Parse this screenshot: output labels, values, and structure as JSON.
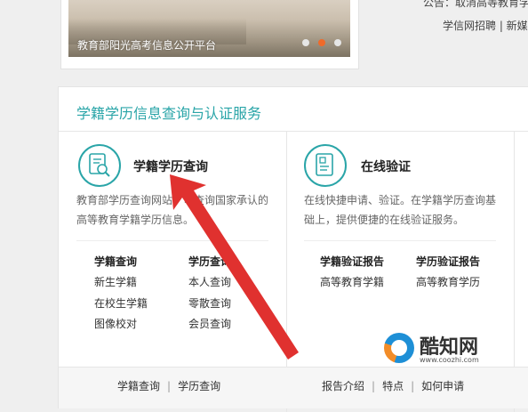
{
  "banner": {
    "caption": "教育部阳光高考信息公开平台",
    "slides": 3,
    "active_slide": 2
  },
  "top_right": {
    "notice": "公告：取消高等教育学",
    "links": "学信网招聘 | 新媒"
  },
  "service": {
    "title": "学籍学历信息查询与认证服务",
    "accent_color": "#2aa5a8",
    "left": {
      "icon": "document-search-icon",
      "name": "学籍学历查询",
      "desc_line1": "教育部学历查询网站，可查询国家承认的",
      "desc_line2": "高等教育学籍学历信息。",
      "groups": [
        {
          "head": "学籍查询",
          "items": [
            "新生学籍",
            "在校生学籍",
            "图像校对"
          ]
        },
        {
          "head": "学历查询",
          "items": [
            "本人查询",
            "零散查询",
            "会员查询"
          ]
        }
      ],
      "footer": [
        "学籍查询",
        "学历查询"
      ]
    },
    "right": {
      "icon": "document-verify-icon",
      "name": "在线验证",
      "desc_line1": "在线快捷申请、验证。在学籍学历查询基",
      "desc_line2": "础上，提供便捷的在线验证服务。",
      "groups": [
        {
          "head": "学籍验证报告",
          "items": [
            "高等教育学籍"
          ]
        },
        {
          "head": "学历验证报告",
          "items": [
            "高等教育学历"
          ]
        }
      ],
      "footer": [
        "报告介绍",
        "特点",
        "如何申请"
      ]
    }
  },
  "watermark": {
    "name": "酷知网",
    "url": "www.coozhi.com"
  }
}
